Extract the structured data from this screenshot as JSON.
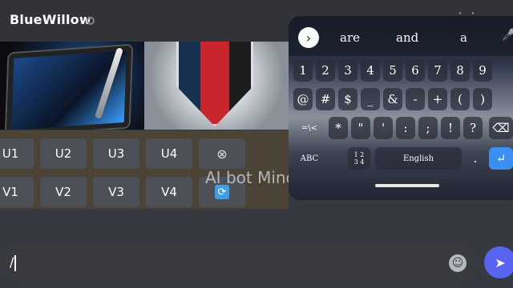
{
  "header": {
    "channel_name": "BlueWillow"
  },
  "buttons": {
    "row1": [
      "U1",
      "U2",
      "U3",
      "U4"
    ],
    "row2": [
      "V1",
      "V2",
      "V3",
      "V4"
    ],
    "delete_glyph": "⊗",
    "refresh_glyph": "⟳"
  },
  "watermark": "AI bot Mind",
  "keyboard": {
    "suggestions": [
      "are",
      "and",
      "a"
    ],
    "numbers": [
      "1",
      "2",
      "3",
      "4",
      "5",
      "6",
      "7",
      "8",
      "9"
    ],
    "symbols_row1": [
      "@",
      "#",
      "$",
      "_",
      "&",
      "-",
      "+",
      "(",
      ")"
    ],
    "symbols_row2": [
      "=\\<",
      "*",
      "\"",
      "'",
      ":",
      ";",
      "!",
      "?"
    ],
    "bottom": {
      "abc": "ABC",
      "num": "1 2\n3 4",
      "space": "English",
      "period": "."
    },
    "enter_glyph": "↵",
    "backspace_glyph": "⌫"
  },
  "composer": {
    "value": "/"
  },
  "icons": {
    "send": "send-icon",
    "emoji": "emoji-icon"
  }
}
